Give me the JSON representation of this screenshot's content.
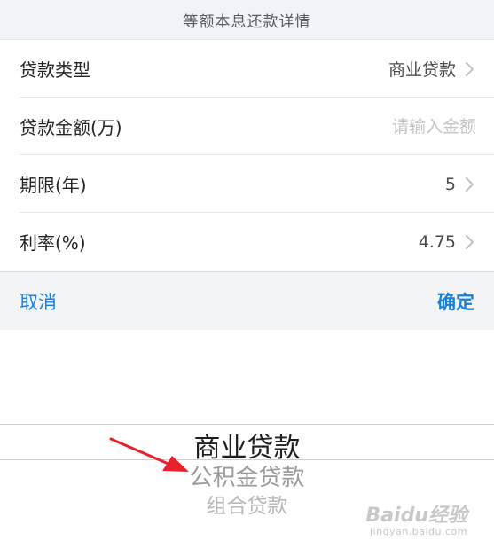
{
  "header": {
    "title": "等额本息还款详情"
  },
  "form": {
    "rows": [
      {
        "label": "贷款类型",
        "value": "商业贷款"
      },
      {
        "label": "贷款金额(万)",
        "placeholder": "请输入金额",
        "value": ""
      },
      {
        "label": "期限(年)",
        "value": "5"
      },
      {
        "label": "利率(%)",
        "value": "4.75"
      }
    ]
  },
  "actions": {
    "cancel_label": "取消",
    "confirm_label": "确定"
  },
  "picker": {
    "options": [
      "商业贷款",
      "公积金贷款",
      "组合贷款"
    ],
    "selected": "商业贷款"
  },
  "watermark": {
    "logo": "Baidu经验",
    "url": "jingyan.baidu.com"
  },
  "colors": {
    "accent": "#1a7fd6",
    "arrow": "#e8202a",
    "header_bg": "#f0f3f7"
  },
  "icons": {
    "row_chevron": "chevron-right-icon",
    "annotation": "red-arrow-icon"
  }
}
